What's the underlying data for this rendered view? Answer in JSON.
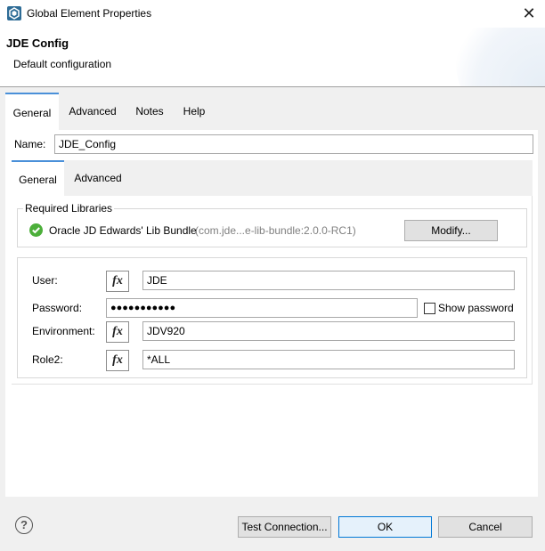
{
  "window": {
    "title": "Global Element Properties",
    "close_symbol": "✕",
    "icon": "app-icon"
  },
  "header": {
    "title": "JDE Config",
    "subtitle": "Default configuration"
  },
  "outer_tabs": [
    {
      "label": "General",
      "selected": true
    },
    {
      "label": "Advanced",
      "selected": false
    },
    {
      "label": "Notes",
      "selected": false
    },
    {
      "label": "Help",
      "selected": false
    }
  ],
  "name_field": {
    "label": "Name:",
    "value": "JDE_Config"
  },
  "inner_tabs": [
    {
      "label": "General",
      "selected": true
    },
    {
      "label": "Advanced",
      "selected": false
    }
  ],
  "required_libraries": {
    "legend": "Required Libraries",
    "status_icon": "check-circle-icon",
    "library_name": "Oracle JD Edwards' Lib Bundle",
    "library_id": "(com.jde...e-lib-bundle:2.0.0-RC1)",
    "modify_label": "Modify..."
  },
  "connection": {
    "fx_label": "fx",
    "user": {
      "label": "User:",
      "value": "JDE"
    },
    "password": {
      "label": "Password:",
      "value": "●●●●●●●●●●●",
      "show_password_label": "Show password",
      "show_password_checked": false
    },
    "environment": {
      "label": "Environment:",
      "value": "JDV920"
    },
    "role": {
      "label": "Role2:",
      "value": "*ALL"
    }
  },
  "footer": {
    "help_symbol": "?",
    "test_connection_label": "Test Connection...",
    "ok_label": "OK",
    "cancel_label": "Cancel"
  },
  "colors": {
    "accent": "#0078d7",
    "tab_indicator": "#4a90d9",
    "status_ok": "#4caf3a"
  }
}
